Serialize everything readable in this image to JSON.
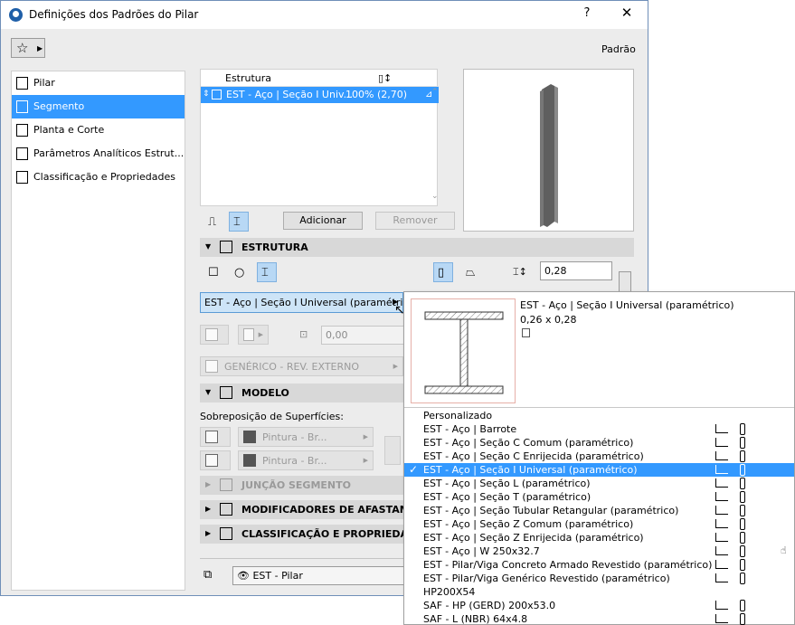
{
  "window": {
    "title": "Definições dos Padrões do Pilar",
    "help": "?",
    "close": "✕",
    "preset": "Padrão"
  },
  "nav": {
    "items": [
      {
        "label": "Pilar",
        "icon": "column-icon"
      },
      {
        "label": "Segmento",
        "icon": "segment-icon",
        "selected": true
      },
      {
        "label": "Planta e Corte",
        "icon": "floor-plan-icon"
      },
      {
        "label": "Parâmetros Analíticos Estrut...",
        "icon": "analytical-icon"
      },
      {
        "label": "Classificação e Propriedades",
        "icon": "classification-icon"
      }
    ]
  },
  "segment_list": {
    "col_structure": "Estrutura",
    "col_size": "▯↕",
    "row": {
      "name": "EST - Aço | Seção I Univ...",
      "value": "100% (2,70)"
    }
  },
  "buttons": {
    "add": "Adicionar",
    "remove": "Remover"
  },
  "sections": {
    "structure": "ESTRUTURA",
    "model": "MODELO",
    "junction": "JUNÇÃO SEGMENTO",
    "offset": "MODIFICADORES DE AFASTAMENTO",
    "classification": "CLASSIFICAÇÃO E PROPRIEDADES"
  },
  "structure": {
    "profile": "EST - Aço | Seção I Universal (paramétri...",
    "width_value": "0,28",
    "offset_value": "0,00",
    "surface": "GENÉRICO - REV. EXTERNO"
  },
  "model": {
    "surface_override_label": "Sobreposição de Superfícies:",
    "paint_1": "Pintura - Br...",
    "paint_2": "Pintura - Br..."
  },
  "footer": {
    "layer": "EST - Pilar"
  },
  "popup": {
    "preview_name": "EST - Aço | Seção I Universal (paramétrico)",
    "preview_dims": "0,26 x 0,28",
    "items": [
      {
        "label": "Personalizado",
        "icons": false
      },
      {
        "label": "EST - Aço | Barrote",
        "icons": true
      },
      {
        "label": "EST - Aço | Seção C Comum (paramétrico)",
        "icons": true
      },
      {
        "label": "EST - Aço | Seção C Enrijecida (paramétrico)",
        "icons": true
      },
      {
        "label": "EST - Aço | Seção I Universal (paramétrico)",
        "icons": true,
        "selected": true
      },
      {
        "label": "EST - Aço | Seção L (paramétrico)",
        "icons": true
      },
      {
        "label": "EST - Aço | Seção T (paramétrico)",
        "icons": true
      },
      {
        "label": "EST - Aço | Seção Tubular Retangular (paramétrico)",
        "icons": true
      },
      {
        "label": "EST - Aço | Seção Z Comum (paramétrico)",
        "icons": true
      },
      {
        "label": "EST - Aço | Seção Z Enrijecida (paramétrico)",
        "icons": true
      },
      {
        "label": "EST - Aço | W 250x32.7",
        "icons": true
      },
      {
        "label": "EST - Pilar/Viga Concreto Armado Revestido (paramétrico)",
        "icons": true
      },
      {
        "label": "EST - Pilar/Viga Genérico Revestido (paramétrico)",
        "icons": true
      },
      {
        "label": "HP200X54",
        "icons": false
      },
      {
        "label": "SAF - HP (GERD) 200x53.0",
        "icons": true
      },
      {
        "label": "SAF - L (NBR) 64x4.8",
        "icons": true
      }
    ]
  },
  "colors": {
    "selection": "#3399ff",
    "toggle_active": "#b8d8f5",
    "panel_bg": "#ececec",
    "section_bg": "#d8d8d8"
  }
}
